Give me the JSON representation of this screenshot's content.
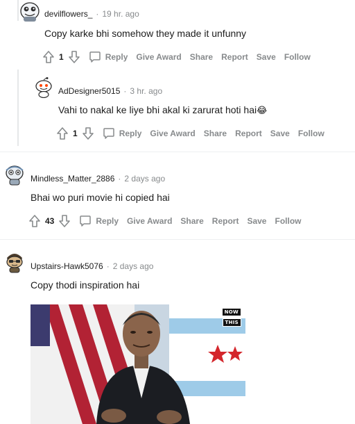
{
  "comments": [
    {
      "username": "devilflowers_",
      "time": "19 hr. ago",
      "text": "Copy karke bhi somehow they made it unfunny",
      "score": "1"
    },
    {
      "username": "AdDesigner5015",
      "time": "3 hr. ago",
      "text": "Vahi to nakal ke liye bhi akal ki zarurat hoti hai",
      "emoji": "😂",
      "score": "1"
    },
    {
      "username": "Mindless_Matter_2886",
      "time": "2 days ago",
      "text": "Bhai wo puri movie hi copied hai",
      "score": "43"
    },
    {
      "username": "Upstairs-Hawk5076",
      "time": "2 days ago",
      "text": "Copy thodi inspiration hai",
      "gif_badge_1": "NOW",
      "gif_badge_2": "THIS"
    }
  ],
  "actions": {
    "reply": "Reply",
    "give_award": "Give Award",
    "share": "Share",
    "report": "Report",
    "save": "Save",
    "follow": "Follow"
  },
  "separator": "·",
  "icons": [
    "upvote-icon",
    "downvote-icon",
    "reply-bubble-icon",
    "snoo-avatar-icon"
  ]
}
